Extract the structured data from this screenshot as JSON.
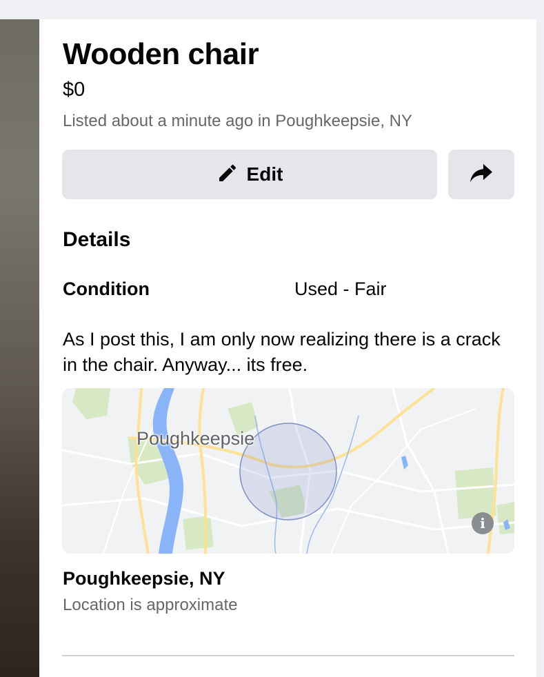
{
  "listing": {
    "title": "Wooden chair",
    "price": "$0",
    "listed_text": "Listed about a minute ago in Poughkeepsie, NY"
  },
  "actions": {
    "edit_label": "Edit",
    "edit_icon": "pencil-icon",
    "share_icon": "share-arrow-icon"
  },
  "details": {
    "heading": "Details",
    "condition_label": "Condition",
    "condition_value": "Used - Fair",
    "description": "As I post this, I am only now realizing there is a crack in the chair. Anyway... its free."
  },
  "map": {
    "city_label": "Poughkeepsie",
    "info_icon": "info-icon",
    "info_glyph": "i"
  },
  "location": {
    "name": "Poughkeepsie, NY",
    "note": "Location is approximate"
  },
  "colors": {
    "button_bg": "#e4e6eb",
    "secondary_text": "#65676b",
    "river": "#8ab4f8",
    "road": "#fde293",
    "park": "#d7e9c4",
    "radius_circle": "#7f8fc6"
  }
}
